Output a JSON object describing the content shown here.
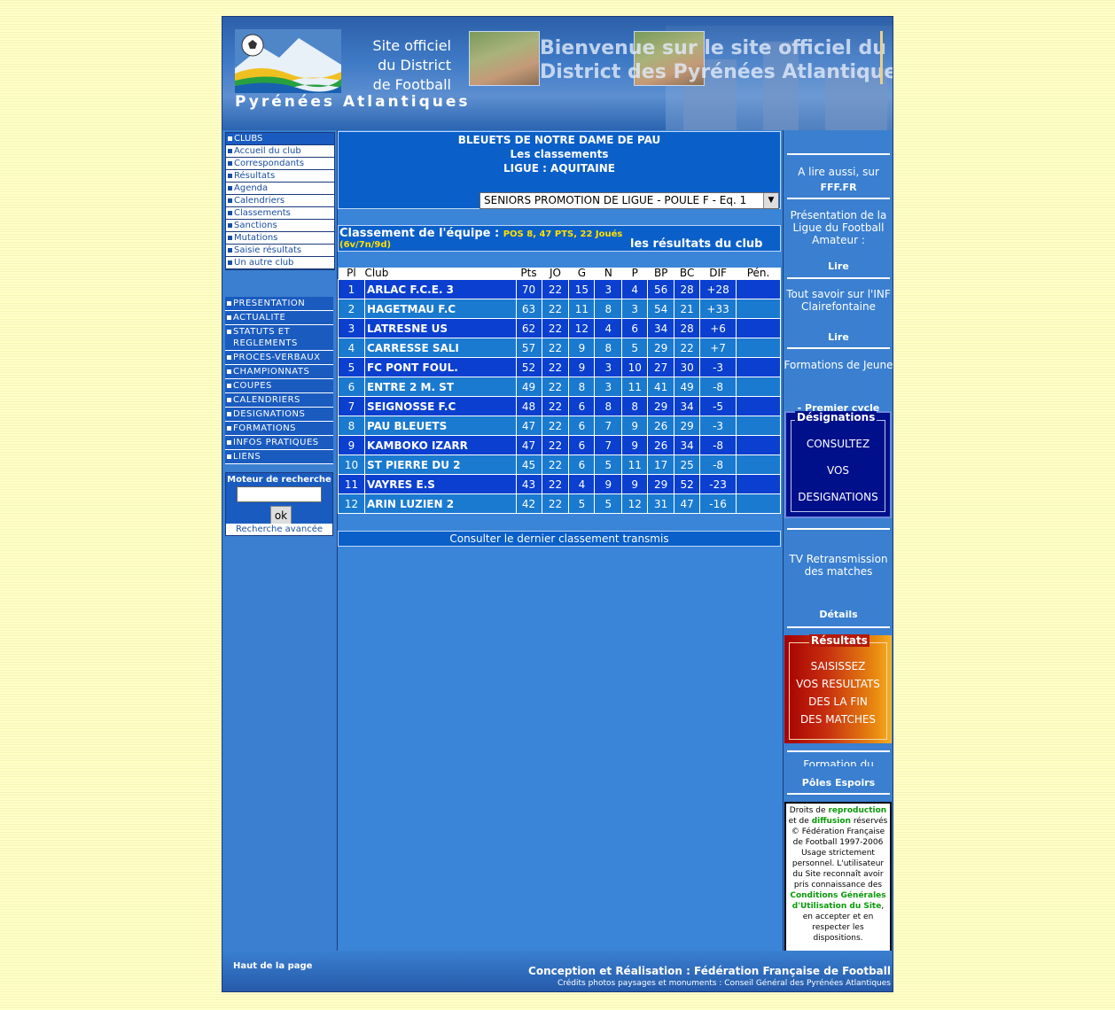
{
  "banner": {
    "title_lines": [
      "Site officiel",
      "du District",
      "de Football"
    ],
    "subtitle": "Pyrénées Atlantiques",
    "welcome_line1": "Bienvenue sur le site officiel du",
    "welcome_line2": "District des Pyrénées Atlantiques"
  },
  "nav_club": [
    {
      "label": "CLUBS"
    },
    {
      "label": "Accueil du club"
    },
    {
      "label": "Correspondants"
    },
    {
      "label": "Résultats"
    },
    {
      "label": "Agenda"
    },
    {
      "label": "Calendriers"
    },
    {
      "label": "Classements"
    },
    {
      "label": "Sanctions"
    },
    {
      "label": "Mutations"
    },
    {
      "label": "Saisie résultats"
    },
    {
      "label": "Un autre club"
    }
  ],
  "nav_main": [
    {
      "label": "PRESENTATION"
    },
    {
      "label": "ACTUALITE"
    },
    {
      "label": "STATUTS ET REGLEMENTS"
    },
    {
      "label": "PROCES-VERBAUX"
    },
    {
      "label": "CHAMPIONNATS"
    },
    {
      "label": "COUPES"
    },
    {
      "label": "CALENDRIERS"
    },
    {
      "label": "DESIGNATIONS"
    },
    {
      "label": "FORMATIONS"
    },
    {
      "label": "INFOS PRATIQUES"
    },
    {
      "label": "LIENS"
    }
  ],
  "search": {
    "title": "Moteur de recherche",
    "value": "",
    "ok_label": "ok",
    "advanced": "Recherche avancée"
  },
  "main": {
    "club_name": "BLEUETS DE NOTRE DAME DE PAU",
    "section": "Les classements",
    "league": "LIGUE : AQUITAINE",
    "select_value": "SENIORS PROMOTION DE LIGUE - POULE F - Eq. 1",
    "class_label": "Classement de l'équipe :",
    "position": "POS 8, 47 PTS, 22 Joués",
    "record": "(6v/7n/9d)",
    "results_link": "les résultats du club",
    "last_link": "Consulter le dernier classement transmis"
  },
  "standings": {
    "headers": [
      "Pl",
      "Club",
      "Pts",
      "JO",
      "G",
      "N",
      "P",
      "BP",
      "BC",
      "DIF",
      "Pén."
    ],
    "rows": [
      [
        "1",
        "ARLAC F.C.E. 3",
        "70",
        "22",
        "15",
        "3",
        "4",
        "56",
        "28",
        "+28",
        ""
      ],
      [
        "2",
        "HAGETMAU F.C",
        "63",
        "22",
        "11",
        "8",
        "3",
        "54",
        "21",
        "+33",
        ""
      ],
      [
        "3",
        "LATRESNE US",
        "62",
        "22",
        "12",
        "4",
        "6",
        "34",
        "28",
        "+6",
        ""
      ],
      [
        "4",
        "CARRESSE SALI",
        "57",
        "22",
        "9",
        "8",
        "5",
        "29",
        "22",
        "+7",
        ""
      ],
      [
        "5",
        "FC PONT FOUL.",
        "52",
        "22",
        "9",
        "3",
        "10",
        "27",
        "30",
        "-3",
        ""
      ],
      [
        "6",
        "ENTRE 2 M. ST",
        "49",
        "22",
        "8",
        "3",
        "11",
        "41",
        "49",
        "-8",
        ""
      ],
      [
        "7",
        "SEIGNOSSE F.C",
        "48",
        "22",
        "6",
        "8",
        "8",
        "29",
        "34",
        "-5",
        ""
      ],
      [
        "8",
        "PAU BLEUETS",
        "47",
        "22",
        "6",
        "7",
        "9",
        "26",
        "29",
        "-3",
        ""
      ],
      [
        "9",
        "KAMBOKO IZARR",
        "47",
        "22",
        "6",
        "7",
        "9",
        "26",
        "34",
        "-8",
        ""
      ],
      [
        "10",
        "ST PIERRE DU 2",
        "45",
        "22",
        "6",
        "5",
        "11",
        "17",
        "25",
        "-8",
        ""
      ],
      [
        "11",
        "VAYRES E.S",
        "43",
        "22",
        "4",
        "9",
        "9",
        "29",
        "52",
        "-23",
        ""
      ],
      [
        "12",
        "ARIN LUZIEN 2",
        "42",
        "22",
        "5",
        "5",
        "12",
        "31",
        "47",
        "-16",
        ""
      ]
    ]
  },
  "right": {
    "read_also": "A lire aussi, sur",
    "fff": "FFF.FR",
    "ligue_text": "Présentation de la Ligue du Football Amateur :",
    "read1": "Lire",
    "inf_text": "Tout savoir sur l'INF Clairefontaine",
    "read2": "Lire",
    "formations_text": "Formations de Jeune",
    "premier_cycle": "- Premier cycle",
    "desig_title": "Désignations",
    "desig_lines": [
      "CONSULTEZ",
      "VOS",
      "DESIGNATIONS"
    ],
    "tv_text": "TV Retransmission des matches",
    "details": "Détails",
    "results_title": "Résultats",
    "results_lines": [
      "SAISISSEZ",
      "VOS RESULTATS",
      "DES LA FIN",
      "DES MATCHES"
    ],
    "formation_du": "Formation du",
    "poles": "Pôles Espoirs",
    "copyright_pre": "Droits de",
    "copyright_repro": "reproduction",
    "copyright_et": "et de",
    "copyright_diff": "diffusion",
    "copyright_mid": "réservés © Fédération Française de Football 1997-2006 Usage strictement personnel. L'utilisateur du Site reconnaît avoir pris connaissance des",
    "copyright_cgu": "Conditions Générales d'Utilisation du Site",
    "copyright_end": ", en accepter et en respecter les dispositions."
  },
  "footer": {
    "top_link": "Haut de la page",
    "credit1": "Conception et Réalisation : Fédération Française de Football",
    "credit2": "Crédits photos paysages et monuments : Conseil Général des Pyrénées Atlantiques"
  }
}
